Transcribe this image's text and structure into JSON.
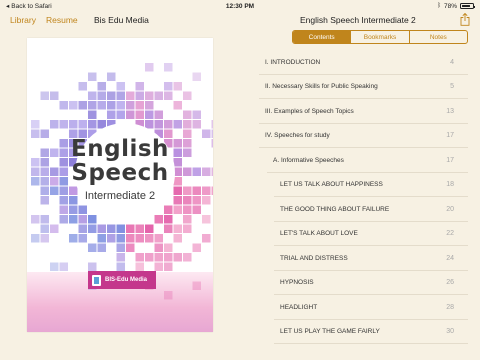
{
  "status_bar": {
    "back_label": "Back to Safari",
    "time": "12:30 PM",
    "battery": "78%",
    "battery_level": 0.78
  },
  "toolbar": {
    "library": "Library",
    "resume": "Resume",
    "app_title": "Bis Edu Media",
    "book_title": "English Speech Intermediate 2"
  },
  "cover": {
    "title_line1": "English",
    "title_line2": "Speech",
    "subtitle": "Intermediate 2",
    "publisher": "BIS-Edu Media"
  },
  "tabs": [
    {
      "label": "Contents",
      "active": true
    },
    {
      "label": "Bookmarks",
      "active": false
    },
    {
      "label": "Notes",
      "active": false
    }
  ],
  "toc": [
    {
      "title": "I. INTRODUCTION",
      "page": "4",
      "level": 0
    },
    {
      "title": "II. Necessary Skills for Public Speaking",
      "page": "5",
      "level": 0
    },
    {
      "title": "III. Examples of Speech Topics",
      "page": "13",
      "level": 0
    },
    {
      "title": "IV. Speeches for study",
      "page": "17",
      "level": 0
    },
    {
      "title": "A. Informative Speeches",
      "page": "17",
      "level": 1
    },
    {
      "title": "LET US TALK ABOUT HAPPINESS",
      "page": "18",
      "level": 2
    },
    {
      "title": "THE GOOD THING ABOUT FAILURE",
      "page": "20",
      "level": 2
    },
    {
      "title": "LET'S TALK ABOUT LOVE",
      "page": "22",
      "level": 2
    },
    {
      "title": "TRIAL AND DISTRESS",
      "page": "24",
      "level": 2
    },
    {
      "title": "HYPNOSIS",
      "page": "26",
      "level": 2
    },
    {
      "title": "HEADLIGHT",
      "page": "28",
      "level": 2
    },
    {
      "title": "LET US PLAY THE GAME FAIRLY",
      "page": "30",
      "level": 2
    }
  ],
  "colors": {
    "accent": "#c0851c",
    "background": "#f7f1e3",
    "page_number": "#a8a8a8"
  }
}
